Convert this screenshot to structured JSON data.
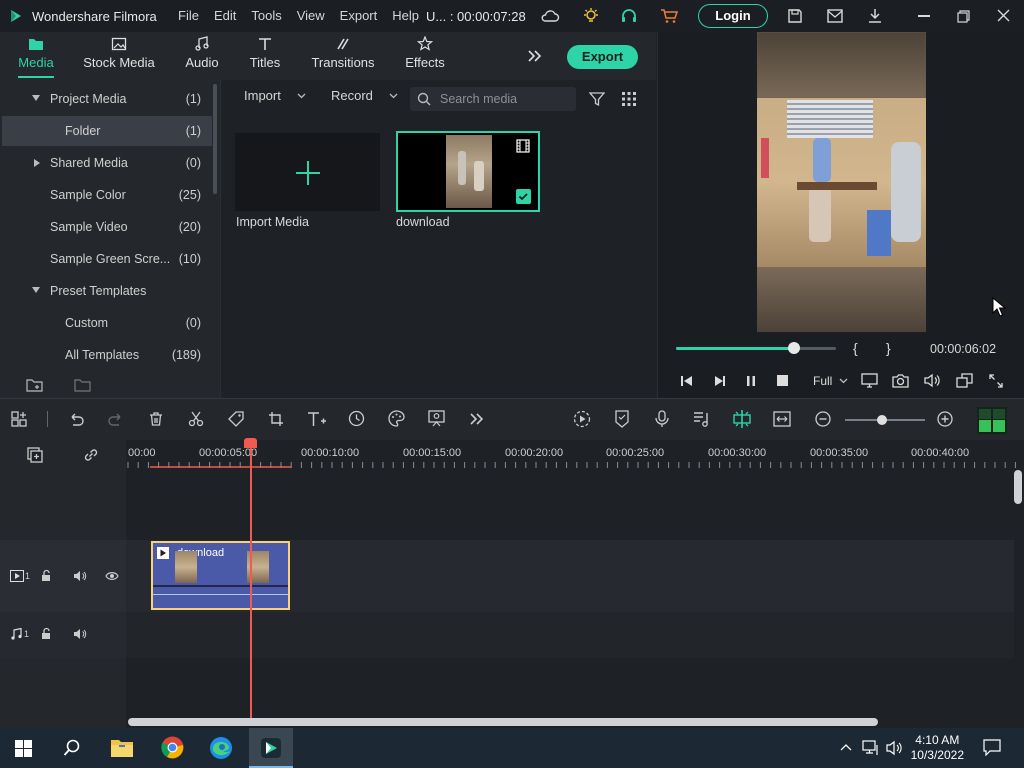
{
  "app": {
    "name": "Wondershare Filmora",
    "project_title": "U... : 00:00:07:28",
    "login_label": "Login",
    "export_label": "Export"
  },
  "menu": [
    "File",
    "Edit",
    "Tools",
    "View",
    "Export",
    "Help"
  ],
  "tabs": [
    {
      "label": "Media",
      "icon": "folder-icon",
      "active": true
    },
    {
      "label": "Stock Media",
      "icon": "image-icon",
      "active": false
    },
    {
      "label": "Audio",
      "icon": "music-note-icon",
      "active": false
    },
    {
      "label": "Titles",
      "icon": "text-icon",
      "active": false
    },
    {
      "label": "Transitions",
      "icon": "transition-icon",
      "active": false
    },
    {
      "label": "Effects",
      "icon": "effects-icon",
      "active": false
    }
  ],
  "sidebar": {
    "items": [
      {
        "label": "Project Media",
        "count": "(1)",
        "level": 0,
        "arrow": "down"
      },
      {
        "label": "Folder",
        "count": "(1)",
        "level": 1,
        "selected": true
      },
      {
        "label": "Shared Media",
        "count": "(0)",
        "level": 0,
        "arrow": "right"
      },
      {
        "label": "Sample Color",
        "count": "(25)",
        "level": 0
      },
      {
        "label": "Sample Video",
        "count": "(20)",
        "level": 0
      },
      {
        "label": "Sample Green Scre...",
        "count": "(10)",
        "level": 0
      },
      {
        "label": "Preset Templates",
        "count": "",
        "level": 0,
        "arrow": "down"
      },
      {
        "label": "Custom",
        "count": "(0)",
        "level": 1
      },
      {
        "label": "All Templates",
        "count": "(189)",
        "level": 1
      }
    ]
  },
  "media_toolbar": {
    "import_label": "Import",
    "record_label": "Record",
    "search_placeholder": "Search media"
  },
  "media_items": {
    "import_label": "Import Media",
    "clip_label": "download"
  },
  "preview": {
    "timecode": "00:00:06:02",
    "quality": "Full",
    "progress": 0.74,
    "mark_in": "{",
    "mark_out": "}"
  },
  "timeline": {
    "ruler": [
      "00:00",
      "00:00:05:00",
      "00:00:10:00",
      "00:00:15:00",
      "00:00:20:00",
      "00:00:25:00",
      "00:00:30:00",
      "00:00:35:00",
      "00:00:40:00"
    ],
    "video_track": "1",
    "audio_track": "1",
    "clip_label": "download"
  },
  "taskbar": {
    "time": "4:10 AM",
    "date": "10/3/2022"
  },
  "colors": {
    "accent": "#2fd3a8",
    "playhead": "#f05a4f",
    "clip_border": "#f6d27a"
  }
}
